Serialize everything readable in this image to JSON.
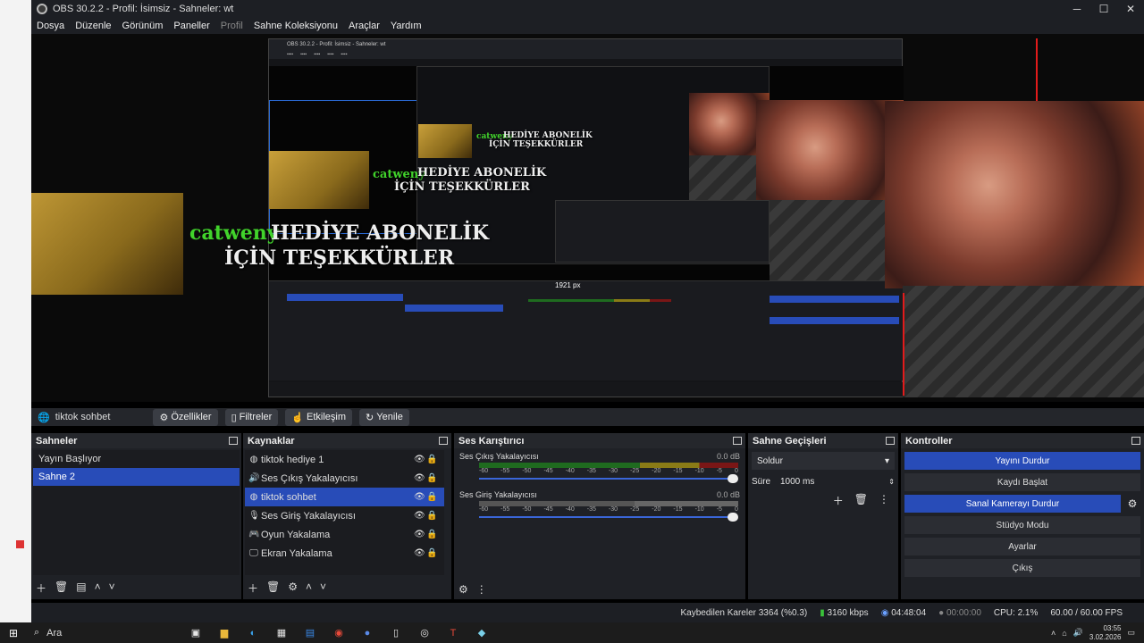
{
  "window": {
    "title": "OBS 30.2.2 - Profil: İsimsiz - Sahneler: wt",
    "minimize": "─",
    "maximize": "☐",
    "close": "✕"
  },
  "menu": [
    "Dosya",
    "Düzenle",
    "Görünüm",
    "Paneller",
    "Profil",
    "Sahne Koleksiyonu",
    "Araçlar",
    "Yardım"
  ],
  "preview": {
    "overlay_green_1": "catweny",
    "overlay_white_1a": "HEDİYE ABONELİK",
    "overlay_white_1b": "İÇİN TEŞEKKÜRLER",
    "overlay_green_2": "catweny",
    "overlay_white_2a": "HEDİYE ABONELİK",
    "overlay_white_2b": "İÇİN TEŞEKKÜRLER",
    "overlay_green_3": "catweny",
    "overlay_white_3a": "HEDİYE ABONELİK",
    "overlay_white_3b": "İÇİN TEŞEKKÜRLER",
    "nested_title": "OBS 30.2.2 - Profil: İsimsiz - Sahneler: wt",
    "nested_px": "1921 px"
  },
  "source_bar": {
    "source_name": "tiktok sohbet",
    "properties": "Özellikler",
    "filters": "Filtreler",
    "interact": "Etkileşim",
    "refresh": "Yenile"
  },
  "scenes": {
    "title": "Sahneler",
    "items": [
      {
        "label": "Yayın Başlıyor",
        "selected": false
      },
      {
        "label": "Sahne 2",
        "selected": true
      }
    ]
  },
  "sources": {
    "title": "Kaynaklar",
    "items": [
      {
        "label": "tiktok hediye 1",
        "icon": "globe-icon",
        "selected": false
      },
      {
        "label": "Ses Çıkış Yakalayıcısı",
        "icon": "speaker-icon",
        "selected": false
      },
      {
        "label": "tiktok sohbet",
        "icon": "globe-icon",
        "selected": true
      },
      {
        "label": "Ses Giriş Yakalayıcısı",
        "icon": "mic-icon",
        "selected": false
      },
      {
        "label": "Oyun Yakalama",
        "icon": "gamepad-icon",
        "selected": false
      },
      {
        "label": "Ekran Yakalama",
        "icon": "monitor-icon",
        "selected": false
      }
    ]
  },
  "mixer": {
    "title": "Ses Karıştırıcı",
    "channels": [
      {
        "name": "Ses Çıkış Yakalayıcısı",
        "db": "0.0 dB",
        "active": true
      },
      {
        "name": "Ses Giriş Yakalayıcısı",
        "db": "0.0 dB",
        "active": false
      }
    ],
    "scale": [
      "-60",
      "-55",
      "-50",
      "-45",
      "-40",
      "-35",
      "-30",
      "-25",
      "-20",
      "-15",
      "-10",
      "-5",
      "0"
    ]
  },
  "transitions": {
    "title": "Sahne Geçişleri",
    "type": "Soldur",
    "duration_label": "Süre",
    "duration_value": "1000 ms"
  },
  "controls": {
    "title": "Kontroller",
    "buttons": [
      {
        "label": "Yayını Durdur",
        "active": true
      },
      {
        "label": "Kaydı Başlat",
        "active": false
      },
      {
        "label": "Sanal Kamerayı Durdur",
        "active": true
      },
      {
        "label": "Stüdyo Modu",
        "active": false
      },
      {
        "label": "Ayarlar",
        "active": false
      },
      {
        "label": "Çıkış",
        "active": false
      }
    ]
  },
  "status": {
    "dropped": "Kaybedilen Kareler 3364 (%0.3)",
    "bitrate": "3160 kbps",
    "live_time": "04:48:04",
    "rec_time": "00:00:00",
    "cpu": "CPU: 2.1%",
    "fps": "60.00 / 60.00 FPS"
  },
  "taskbar": {
    "search": "Ara",
    "time": "03:55",
    "date": "3.02.2026"
  },
  "colors": {
    "accent": "#284cb8",
    "overlay_green": "#41d32b",
    "red_marker": "#e21b1b"
  }
}
